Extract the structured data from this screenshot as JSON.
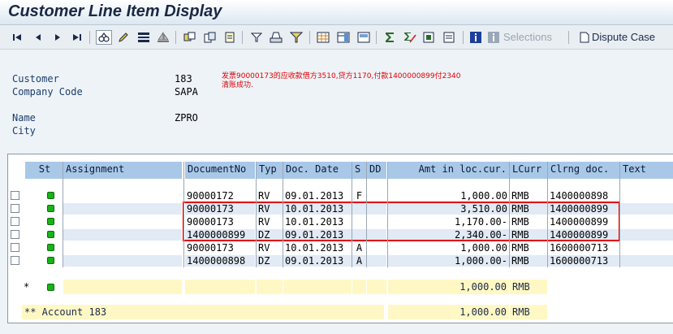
{
  "window": {
    "title": "Customer Line Item Display"
  },
  "toolbar": {
    "selections_label": "Selections",
    "dispute_case_label": "Dispute Case"
  },
  "header": {
    "customer_label": "Customer",
    "customer_value": "183",
    "company_code_label": "Company Code",
    "company_code_value": "SAPA",
    "name_label": "Name",
    "name_value": "ZPRO",
    "city_label": "City",
    "note_line1": "发票90000173的应收款借方3510,贷方1170,付款1400000899付2340",
    "note_line2": "清账成功."
  },
  "table": {
    "columns": {
      "st": "St",
      "assignment": "Assignment",
      "document_no": "DocumentNo",
      "typ": "Typ",
      "doc_date": "Doc. Date",
      "s": "S",
      "dd": "DD",
      "amount": "Amt in loc.cur.",
      "lcurr": "LCurr",
      "clrng_doc": "Clrng doc.",
      "text": "Text"
    },
    "rows": [
      {
        "document_no": "90000172",
        "typ": "RV",
        "doc_date": "09.01.2013",
        "s": "F",
        "dd": "",
        "amount": "1,000.00",
        "lcurr": "RMB",
        "clrng_doc": "1400000898"
      },
      {
        "document_no": "90000173",
        "typ": "RV",
        "doc_date": "10.01.2013",
        "s": "",
        "dd": "",
        "amount": "3,510.00",
        "lcurr": "RMB",
        "clrng_doc": "1400000899"
      },
      {
        "document_no": "90000173",
        "typ": "RV",
        "doc_date": "10.01.2013",
        "s": "",
        "dd": "",
        "amount": "1,170.00-",
        "lcurr": "RMB",
        "clrng_doc": "1400000899"
      },
      {
        "document_no": "1400000899",
        "typ": "DZ",
        "doc_date": "09.01.2013",
        "s": "",
        "dd": "",
        "amount": "2,340.00-",
        "lcurr": "RMB",
        "clrng_doc": "1400000899"
      },
      {
        "document_no": "90000173",
        "typ": "RV",
        "doc_date": "10.01.2013",
        "s": "A",
        "dd": "",
        "amount": "1,000.00",
        "lcurr": "RMB",
        "clrng_doc": "1600000713"
      },
      {
        "document_no": "1400000898",
        "typ": "DZ",
        "doc_date": "09.01.2013",
        "s": "A",
        "dd": "",
        "amount": "1,000.00-",
        "lcurr": "RMB",
        "clrng_doc": "1600000713"
      }
    ],
    "subtotal": {
      "marker": "*",
      "amount": "1,000.00",
      "lcurr": "RMB"
    },
    "total": {
      "label": "** Account 183",
      "amount": "1,000.00",
      "lcurr": "RMB"
    }
  },
  "colors": {
    "header_blue": "#a9c8e8",
    "highlight_red": "#e00000",
    "status_green": "#17b317",
    "total_yellow": "#fff8c4"
  }
}
